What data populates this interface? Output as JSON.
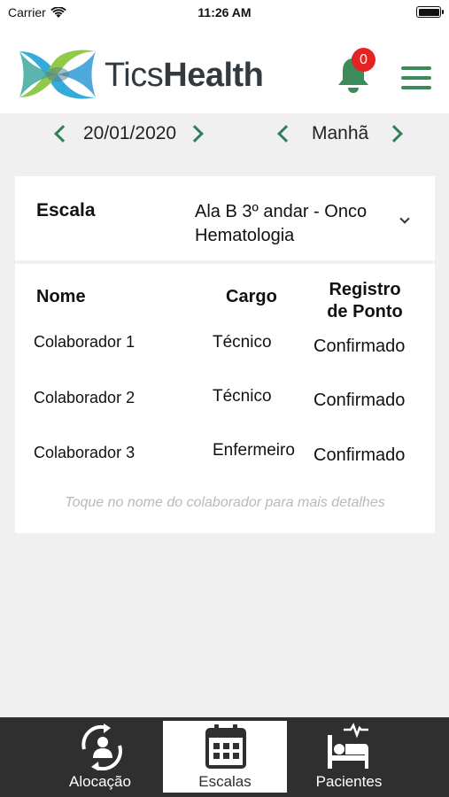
{
  "status_bar": {
    "carrier": "Carrier",
    "time": "11:26 AM"
  },
  "header": {
    "brand_light": "Tics",
    "brand_bold": "Health",
    "notification_count": "0",
    "colors": {
      "green": "#3d8a5b",
      "blue": "#2aa7d9",
      "lime": "#8dc63f",
      "badge": "#e52323"
    }
  },
  "date_nav": {
    "date": "20/01/2020",
    "shift": "Manhã"
  },
  "escala": {
    "label": "Escala",
    "value": "Ala B 3º andar - Onco Hematologia"
  },
  "table": {
    "headers": {
      "nome": "Nome",
      "cargo": "Cargo",
      "registro_line1": "Registro",
      "registro_line2": "de Ponto"
    },
    "rows": [
      {
        "nome": "Colaborador 1",
        "cargo": "Técnico",
        "registro": "Confirmado"
      },
      {
        "nome": "Colaborador 2",
        "cargo": "Técnico",
        "registro": "Confirmado"
      },
      {
        "nome": "Colaborador 3",
        "cargo": "Enfermeiro",
        "registro": "Confirmado"
      }
    ],
    "hint": "Toque no nome do colaborador para mais detalhes"
  },
  "tabs": [
    {
      "label": "Alocação",
      "icon": "allocation-icon",
      "active": false
    },
    {
      "label": "Escalas",
      "icon": "calendar-icon",
      "active": true
    },
    {
      "label": "Pacientes",
      "icon": "patient-bed-icon",
      "active": false
    }
  ]
}
